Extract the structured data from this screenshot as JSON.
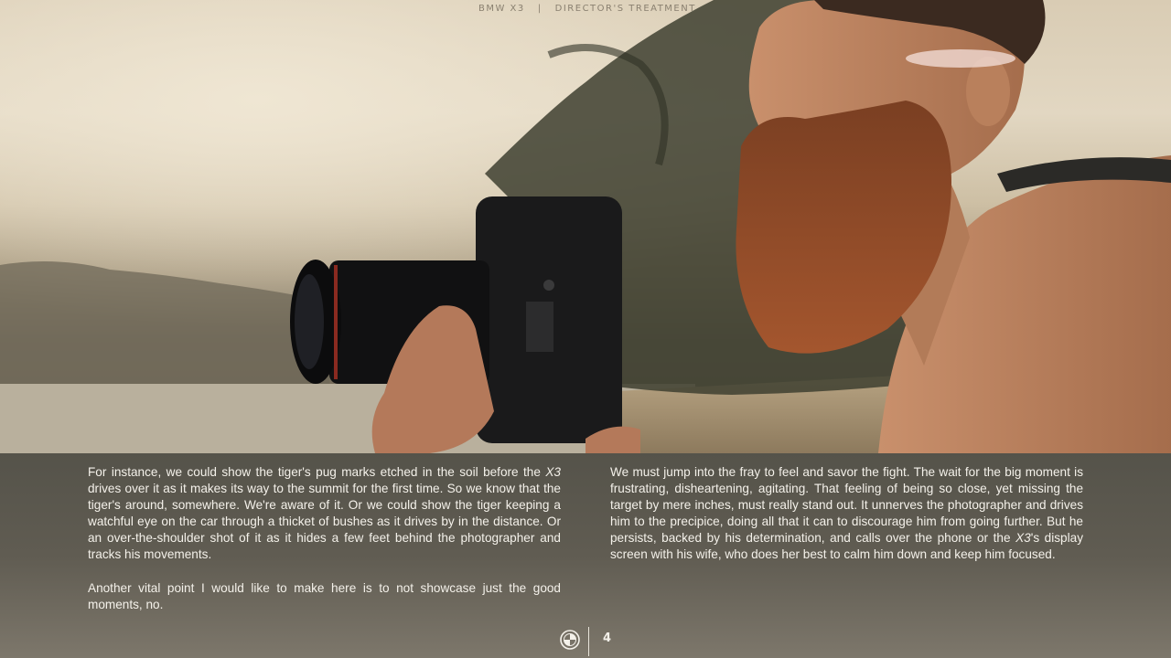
{
  "header": {
    "brand": "BMW X3",
    "separator": "|",
    "section": "DIRECTOR'S TREATMENT"
  },
  "photo": {
    "icon": "photographer-with-camera-photo"
  },
  "left_column": {
    "p1": {
      "a": "For instance, we could show the tiger's pug marks etched in the soil before the ",
      "em": "X3",
      "b": " drives over it as it makes its way to the summit for the first time. So we know that the tiger's around, somewhere. We're aware of it. Or we could show the tiger keeping a watchful eye on the car through a thicket of bushes as it drives by in the distance. Or an over-the-shoulder shot of it as it hides a few feet behind the photographer and tracks his movements."
    },
    "p2": "Another vital point I would like to make here is to not showcase just the good moments, no."
  },
  "right_column": {
    "p1": {
      "a": "We must jump into the fray to feel and savor the fight. The wait for the big moment is frustrating, disheartening, agitating. That feeling of being so close, yet missing the target by mere inches, must really stand out. It unnerves the photographer and drives him to the precipice, doing all that it can to discourage him from going further. But he persists, backed by his determination, and calls over the phone or the ",
      "em": "X3",
      "b": "'s display screen with his wife, who does her best to calm him down and keep him focused."
    }
  },
  "footer": {
    "logo_icon": "bmw-logo-icon",
    "page_number": "4"
  },
  "colors": {
    "text": "#f4f1ea",
    "background": "#5e5a4f"
  }
}
